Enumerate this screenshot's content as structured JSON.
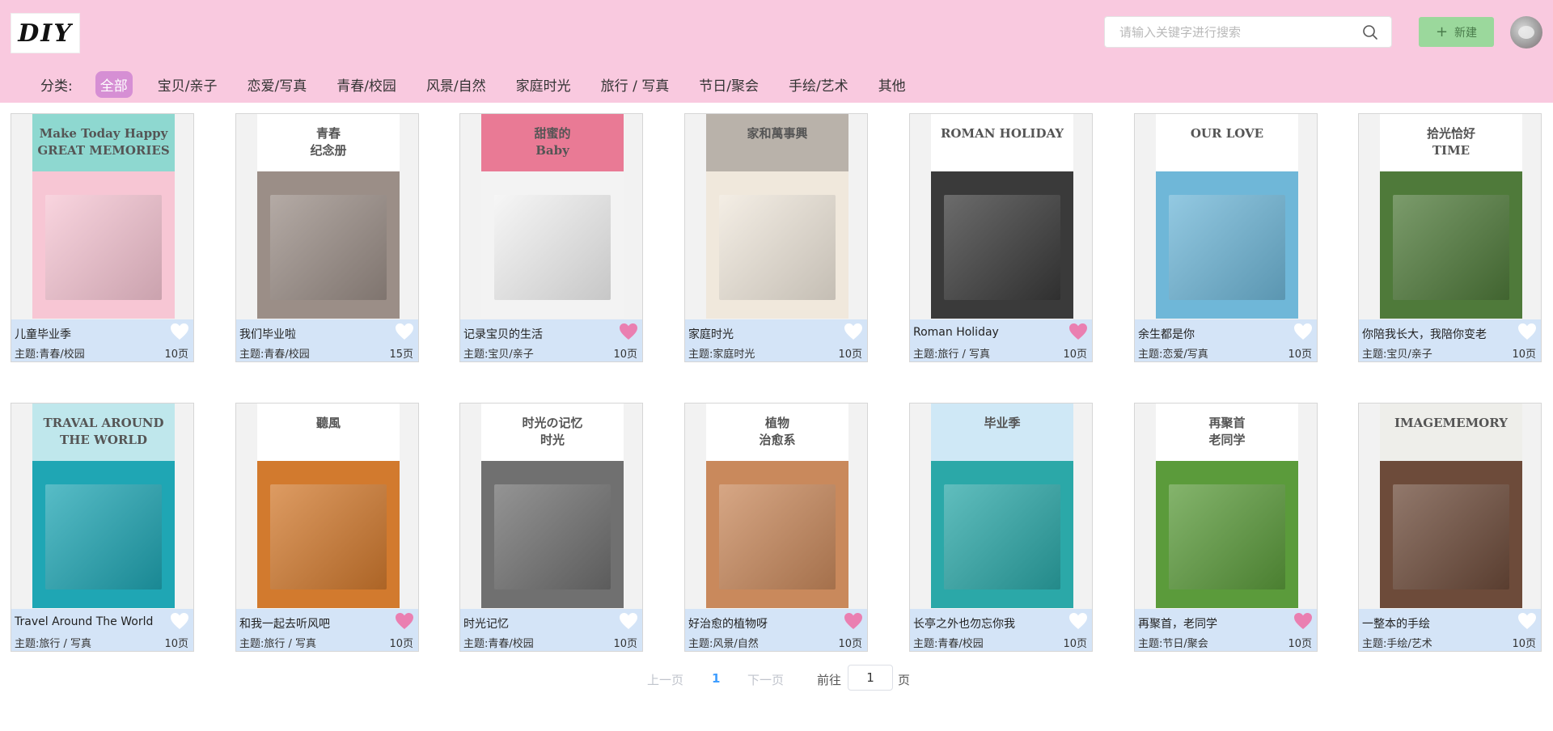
{
  "header": {
    "logo_text": "DIY",
    "search_placeholder": "请输入关键字进行搜索",
    "new_button_label": "新建"
  },
  "categories": {
    "label": "分类:",
    "items": [
      "全部",
      "宝贝/亲子",
      "恋爱/写真",
      "青春/校园",
      "风景/自然",
      "家庭时光",
      "旅行 / 写真",
      "节日/聚会",
      "手绘/艺术",
      "其他"
    ],
    "active_index": 0
  },
  "cards": [
    {
      "title": "儿童毕业季",
      "theme": "主题:青春/校园",
      "pages": "10页",
      "liked": false,
      "thumb_colors": [
        "#8ed8d0",
        "#f7c6d4"
      ],
      "thumb_text": [
        "Make Today Happy",
        "GREAT MEMORIES"
      ]
    },
    {
      "title": "我们毕业啦",
      "theme": "主题:青春/校园",
      "pages": "15页",
      "liked": false,
      "thumb_colors": [
        "#ffffff",
        "#9b8e87"
      ],
      "thumb_text": [
        "青春",
        "纪念册"
      ]
    },
    {
      "title": "记录宝贝的生活",
      "theme": "主题:宝贝/亲子",
      "pages": "10页",
      "liked": true,
      "thumb_colors": [
        "#e97a95",
        "#f3f3f3"
      ],
      "thumb_text": [
        "甜蜜的",
        "Baby"
      ]
    },
    {
      "title": "家庭时光",
      "theme": "主题:家庭时光",
      "pages": "10页",
      "liked": false,
      "thumb_colors": [
        "#b9b2aa",
        "#f0e8dc"
      ],
      "thumb_text": [
        "家和萬事興"
      ]
    },
    {
      "title": "Roman Holiday",
      "theme": "主题:旅行 / 写真",
      "pages": "10页",
      "liked": true,
      "thumb_colors": [
        "#ffffff",
        "#3a3a3a"
      ],
      "thumb_text": [
        "ROMAN HOLIDAY"
      ]
    },
    {
      "title": "余生都是你",
      "theme": "主题:恋爱/写真",
      "pages": "10页",
      "liked": false,
      "thumb_colors": [
        "#ffffff",
        "#6fb7d8"
      ],
      "thumb_text": [
        "OUR LOVE"
      ]
    },
    {
      "title": "你陪我长大，我陪你变老",
      "theme": "主题:宝贝/亲子",
      "pages": "10页",
      "liked": false,
      "thumb_colors": [
        "#ffffff",
        "#4f7a3a"
      ],
      "thumb_text": [
        "拾光恰好",
        "TIME"
      ]
    },
    {
      "title": "Travel Around The World",
      "theme": "主题:旅行 / 写真",
      "pages": "10页",
      "liked": false,
      "thumb_colors": [
        "#bfe7ec",
        "#1fa6b4"
      ],
      "thumb_text": [
        "TRAVAL AROUND THE WORLD"
      ]
    },
    {
      "title": "和我一起去听风吧",
      "theme": "主题:旅行 / 写真",
      "pages": "10页",
      "liked": true,
      "thumb_colors": [
        "#ffffff",
        "#d27a2e"
      ],
      "thumb_text": [
        "聽風"
      ]
    },
    {
      "title": "时光记忆",
      "theme": "主题:青春/校园",
      "pages": "10页",
      "liked": false,
      "thumb_colors": [
        "#ffffff",
        "#707070"
      ],
      "thumb_text": [
        "时光の记忆",
        "时光"
      ]
    },
    {
      "title": "好治愈的植物呀",
      "theme": "主题:风景/自然",
      "pages": "10页",
      "liked": true,
      "thumb_colors": [
        "#ffffff",
        "#c9895c"
      ],
      "thumb_text": [
        "植物",
        "治愈系"
      ]
    },
    {
      "title": "长亭之外也勿忘你我",
      "theme": "主题:青春/校园",
      "pages": "10页",
      "liked": false,
      "thumb_colors": [
        "#cfe8f6",
        "#2ba8a8"
      ],
      "thumb_text": [
        "毕业季"
      ]
    },
    {
      "title": "再聚首，老同学",
      "theme": "主题:节日/聚会",
      "pages": "10页",
      "liked": true,
      "thumb_colors": [
        "#ffffff",
        "#5b9b3b"
      ],
      "thumb_text": [
        "再聚首",
        "老同学"
      ]
    },
    {
      "title": "一整本的手绘",
      "theme": "主题:手绘/艺术",
      "pages": "10页",
      "liked": false,
      "thumb_colors": [
        "#eeeeea",
        "#6d4b3a"
      ],
      "thumb_text": [
        "IMAGEMEMORY"
      ]
    }
  ],
  "pagination": {
    "prev_label": "上一页",
    "current_page": "1",
    "next_label": "下一页",
    "goto_label": "前往",
    "goto_value": "1",
    "page_unit": "页"
  },
  "colors": {
    "header_bg": "#f9c9df",
    "active_category": "#d68fd4",
    "card_info_bg": "#d4e4f7",
    "heart_liked": "#ea7fb1",
    "heart_unliked": "#ffffff",
    "new_button_bg": "#9bd89c",
    "page_active": "#409eff"
  }
}
